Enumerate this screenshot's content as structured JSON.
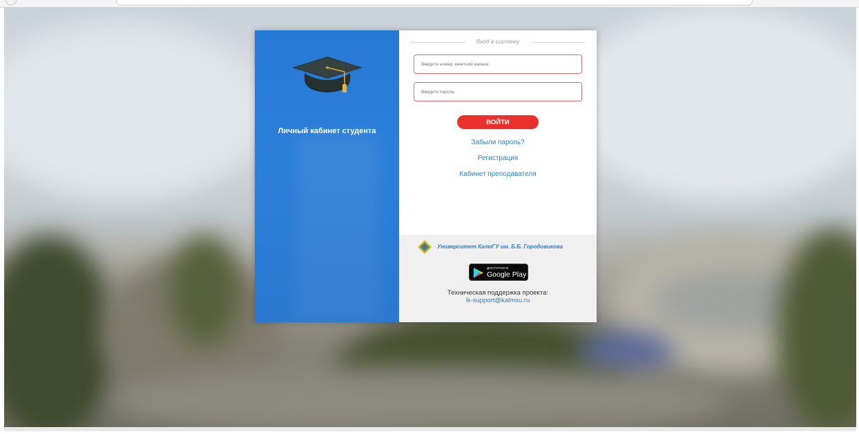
{
  "colors": {
    "panel_blue": "#2a7cd6",
    "accent_red": "#e8302c",
    "link_blue": "#2a7fc9",
    "input_border": "#e06a6a"
  },
  "left_panel": {
    "icon": "graduation-cap-icon",
    "title": "Личный кабинет студента"
  },
  "login_form": {
    "heading": "Вход в систему",
    "record_book_input": {
      "placeholder": "Введите номер зачетной книжки",
      "value": ""
    },
    "password_input": {
      "placeholder": "Введите пароль",
      "value": ""
    },
    "submit_label": "ВОЙТИ",
    "links": {
      "forgot_password": "Забыли пароль?",
      "register": "Регистрация",
      "teacher_cabinet": "Кабинет преподавателя"
    }
  },
  "footer": {
    "university_logo": "university-logo-icon",
    "university_name": "Университет КалмГУ им. Б.Б. Городовикова",
    "google_play": {
      "small_text": "ДОСТУПНО В",
      "big_text": "Google Play",
      "icon": "google-play-icon"
    },
    "support_label": "Техническая поддержка проекта:",
    "support_email": "lk-support@kalmsu.ru"
  }
}
